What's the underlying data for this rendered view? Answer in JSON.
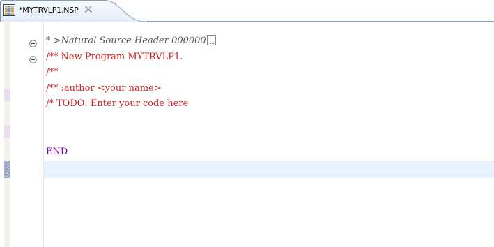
{
  "tab": {
    "title": "*MYTRVLP1.NSP",
    "icon": "natural-source-file-icon",
    "close_icon": "close-icon"
  },
  "editor": {
    "lines": [
      {
        "text": "* >Natural Source Header 000000",
        "style": "header",
        "folded": true
      },
      {
        "text": "/** New Program MYTRVLP1.",
        "style": "comment",
        "fold": "expanded"
      },
      {
        "text": "/**",
        "style": "comment"
      },
      {
        "text": "/** :author <your name>",
        "style": "comment"
      },
      {
        "text": "/* TODO: Enter your code here",
        "style": "comment"
      },
      {
        "text": "",
        "style": "plain"
      },
      {
        "text": "END",
        "style": "keyword"
      },
      {
        "text": "",
        "style": "plain",
        "current": true
      }
    ]
  },
  "colors": {
    "comment": "#d02020",
    "keyword": "#7a00a8",
    "header": "#555555",
    "current_line": "#e8f2fe",
    "annotation": "#e8dced"
  }
}
